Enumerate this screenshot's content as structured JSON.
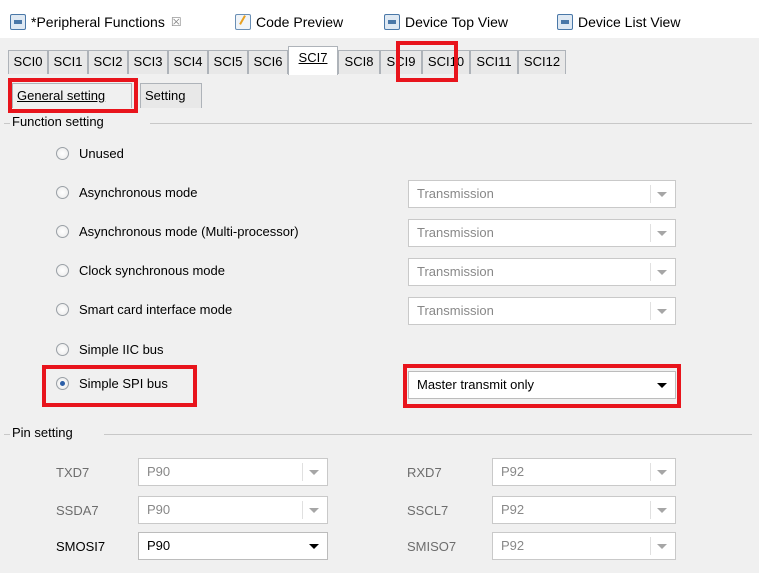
{
  "editor_tabs": [
    {
      "label": "*Peripheral Functions",
      "icon": "chip-icon",
      "close": "☒"
    },
    {
      "label": "Code Preview",
      "icon": "code-icon"
    },
    {
      "label": "Device Top View",
      "icon": "chip-icon"
    },
    {
      "label": "Device List View",
      "icon": "chip-icon"
    }
  ],
  "sci_tabs": [
    "SCI0",
    "SCI1",
    "SCI2",
    "SCI3",
    "SCI4",
    "SCI5",
    "SCI6",
    "SCI7",
    "SCI8",
    "SCI9",
    "SCI10",
    "SCI11",
    "SCI12"
  ],
  "sci_active": "SCI7",
  "sub_tabs": [
    "General setting",
    "Setting"
  ],
  "sub_active": "General setting",
  "function_setting": {
    "title": "Function setting",
    "options": [
      {
        "label": "Unused",
        "checked": false
      },
      {
        "label": "Asynchronous mode",
        "checked": false,
        "combo": "Transmission"
      },
      {
        "label": "Asynchronous mode (Multi-processor)",
        "checked": false,
        "combo": "Transmission"
      },
      {
        "label": "Clock synchronous mode",
        "checked": false,
        "combo": "Transmission"
      },
      {
        "label": "Smart card interface mode",
        "checked": false,
        "combo": "Transmission"
      },
      {
        "label": "Simple IIC bus",
        "checked": false
      },
      {
        "label": "Simple SPI bus",
        "checked": true,
        "combo": "Master transmit only"
      }
    ]
  },
  "pin_setting": {
    "title": "Pin setting",
    "rows": [
      {
        "left_label": "TXD7",
        "left_value": "P90",
        "right_label": "RXD7",
        "right_value": "P92"
      },
      {
        "left_label": "SSDA7",
        "left_value": "P90",
        "right_label": "SSCL7",
        "right_value": "P92"
      },
      {
        "left_label": "SMOSI7",
        "left_value": "P90",
        "right_label": "SMISO7",
        "right_value": "P92"
      }
    ]
  },
  "colors": {
    "highlight": "#e8141c",
    "radio_checked": "#2c5fa8"
  }
}
